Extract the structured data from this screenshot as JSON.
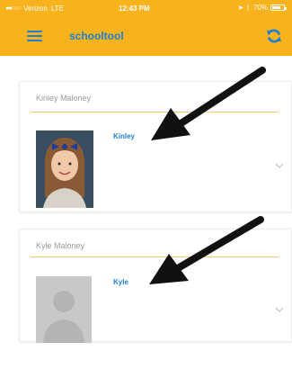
{
  "status_bar": {
    "carrier": "Verizon",
    "network": "LTE",
    "time": "12:43 PM",
    "battery": "70%"
  },
  "app_bar": {
    "brand": "schooltool"
  },
  "students": [
    {
      "parent_name": "Kinley Maloney",
      "student_name": "Kinley",
      "photo": "student-photo"
    },
    {
      "parent_name": "Kyle Maloney",
      "student_name": "Kyle",
      "photo": "placeholder-avatar"
    }
  ],
  "colors": {
    "accent": "#f7b21c",
    "link": "#1d7fd6",
    "muted_text": "#9a9a9a",
    "divider": "#f7c96e",
    "arrow": "#111111"
  },
  "icons": [
    "signal-dots-icon",
    "location-icon",
    "bluetooth-icon",
    "battery-icon",
    "hamburger-icon",
    "refresh-icon",
    "chevron-down-icon",
    "annotation-arrow"
  ]
}
